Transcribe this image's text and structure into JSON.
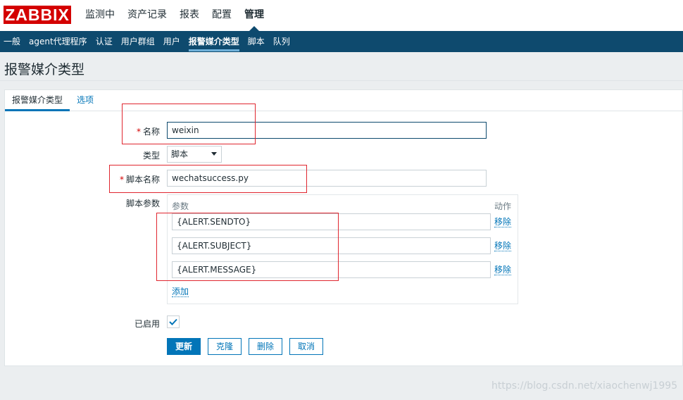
{
  "logo": {
    "text": "ZABBIX"
  },
  "top_nav": [
    {
      "label": "监测中"
    },
    {
      "label": "资产记录"
    },
    {
      "label": "报表"
    },
    {
      "label": "配置"
    },
    {
      "label": "管理"
    }
  ],
  "sub_nav": [
    {
      "label": "一般"
    },
    {
      "label": "agent代理程序"
    },
    {
      "label": "认证"
    },
    {
      "label": "用户群组"
    },
    {
      "label": "用户"
    },
    {
      "label": "报警媒介类型"
    },
    {
      "label": "脚本"
    },
    {
      "label": "队列"
    }
  ],
  "page": {
    "title": "报警媒介类型"
  },
  "tabs": [
    {
      "label": "报警媒介类型"
    },
    {
      "label": "选项"
    }
  ],
  "form": {
    "name_label": "名称",
    "name_value": "weixin",
    "type_label": "类型",
    "type_value": "脚本",
    "script_name_label": "脚本名称",
    "script_name_value": "wechatsuccess.py",
    "params_label": "脚本参数",
    "params_header": "参数",
    "action_header": "动作",
    "params": [
      {
        "value": "{ALERT.SENDTO}",
        "remove": "移除"
      },
      {
        "value": "{ALERT.SUBJECT}",
        "remove": "移除"
      },
      {
        "value": "{ALERT.MESSAGE}",
        "remove": "移除"
      }
    ],
    "add_label": "添加",
    "enabled_label": "已启用",
    "enabled": true
  },
  "buttons": {
    "update": "更新",
    "clone": "克隆",
    "delete": "删除",
    "cancel": "取消"
  },
  "watermark": "https://blog.csdn.net/xiaochenwj1995",
  "colors": {
    "brand_red": "#d40000",
    "nav_dark": "#0e4a6e",
    "accent": "#0275b8",
    "annotation_red": "#e0262f"
  }
}
